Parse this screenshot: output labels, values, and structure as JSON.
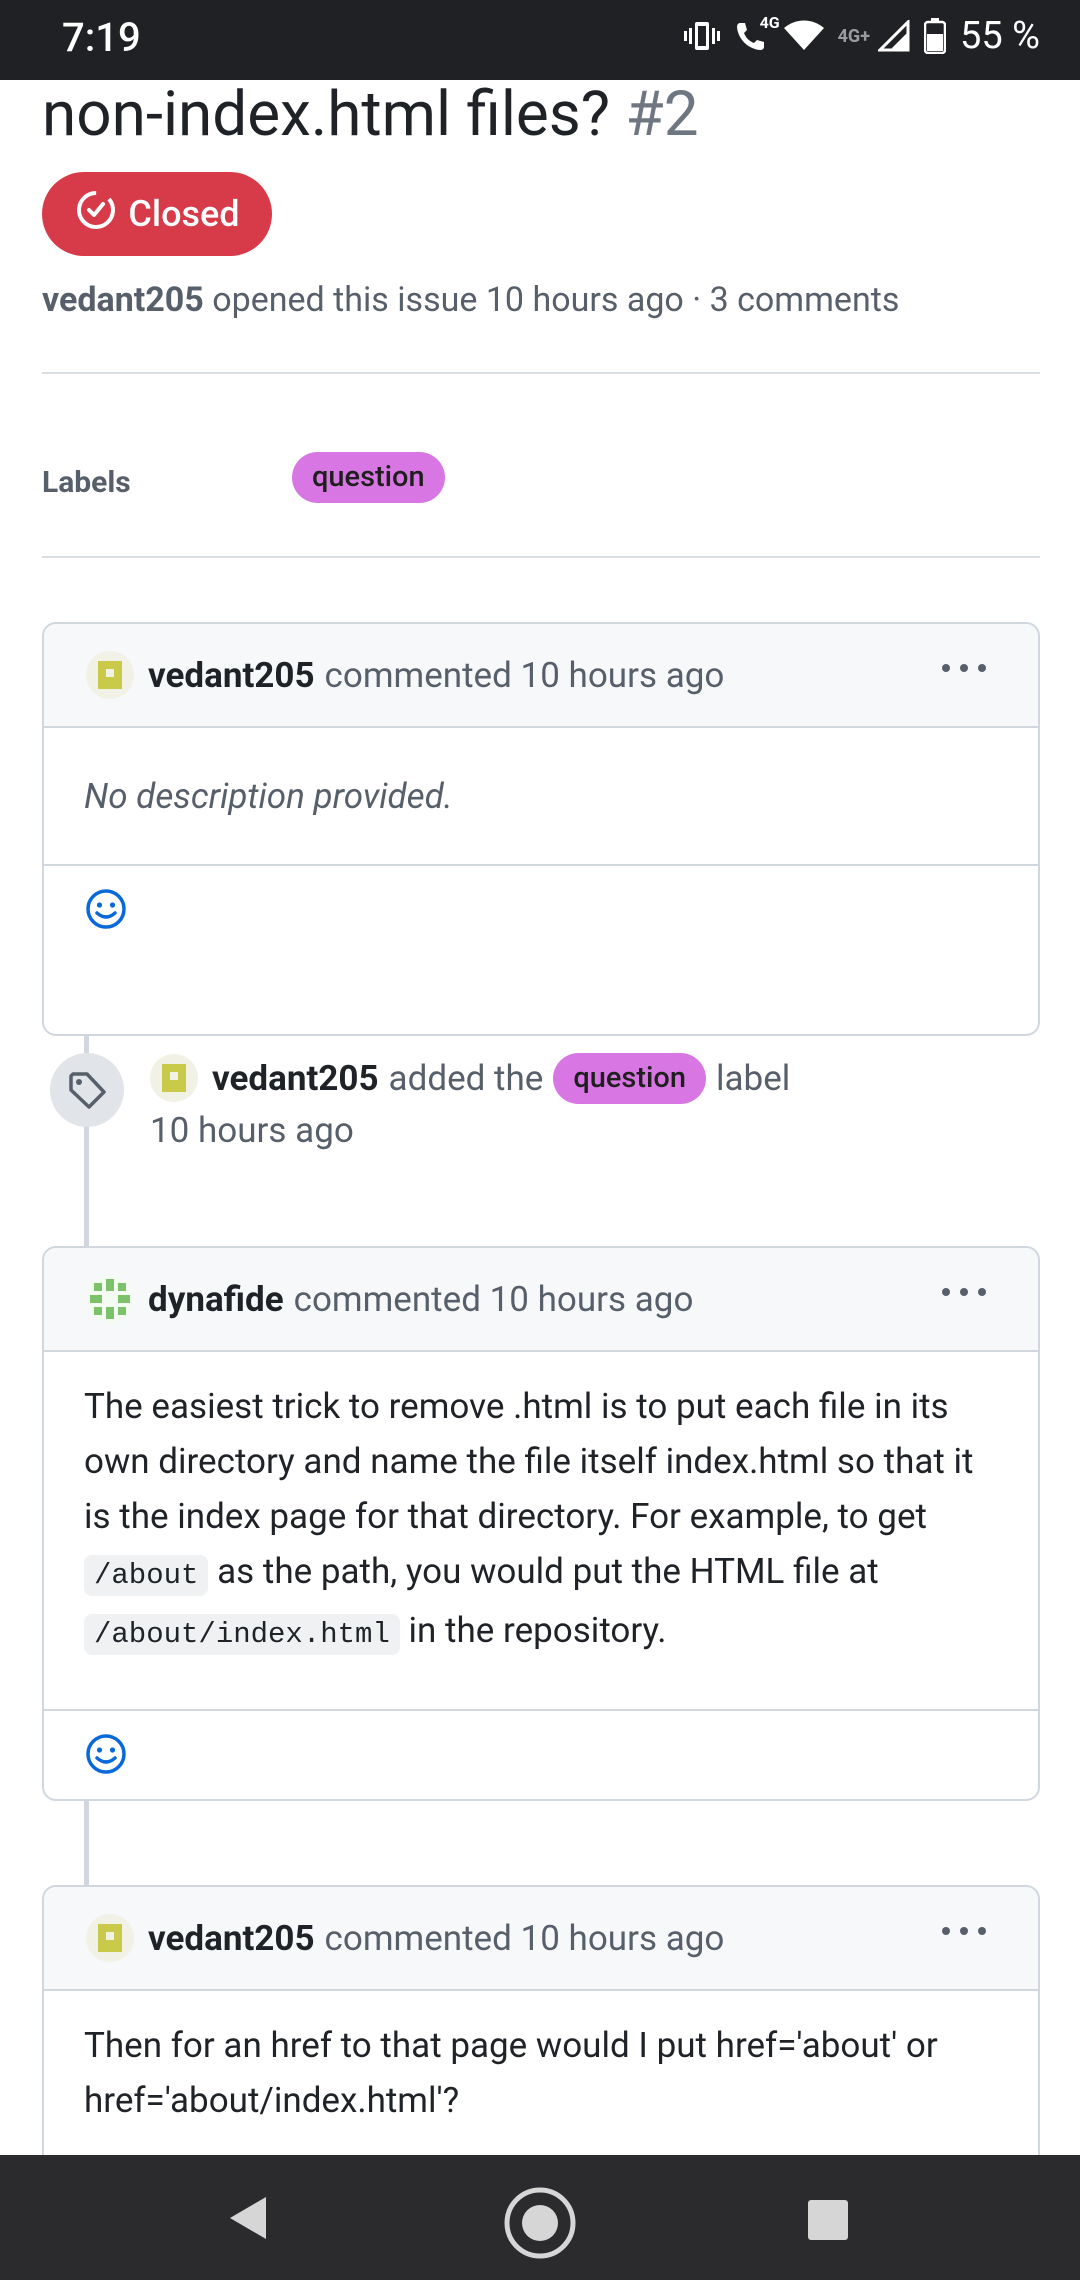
{
  "status_bar": {
    "time": "7:19",
    "network_call": "4G",
    "network_data": "4G+",
    "battery": "55 %",
    "icons": [
      "vibrate-icon",
      "wifi-call-icon",
      "wifi-icon",
      "signal-icon",
      "battery-icon"
    ]
  },
  "issue": {
    "title": "non-index.html files?",
    "number": "#2",
    "state": "Closed",
    "author": "vedant205",
    "meta_text": " opened this issue 10 hours ago · 3 comments"
  },
  "labels": {
    "heading": "Labels",
    "items": [
      "question"
    ]
  },
  "timeline": {
    "comment1": {
      "author": "vedant205",
      "action": "commented 10 hours ago",
      "body": "No description provided."
    },
    "event": {
      "author": "vedant205",
      "prefix": "added the",
      "label": "question",
      "suffix": "label",
      "time": "10 hours ago"
    },
    "comment2": {
      "author": "dynafide",
      "action": "commented 10 hours ago",
      "body_part1": "The easiest trick to remove .html is to put each file in its own directory and name the file itself index.html so that it is the index page for that directory. For example, to get ",
      "code1": "/about",
      "body_part2": " as the path, you would put the HTML file at ",
      "code2": "/about/index.html",
      "body_part3": " in the repository."
    },
    "comment3": {
      "author": "vedant205",
      "action": "commented 10 hours ago",
      "body": "Then for an href to that page would I put href='about' or href='about/index.html'?"
    }
  },
  "colors": {
    "closed_red": "#d73a49",
    "label_question": "#d876e3",
    "link_blue": "#0969da"
  }
}
